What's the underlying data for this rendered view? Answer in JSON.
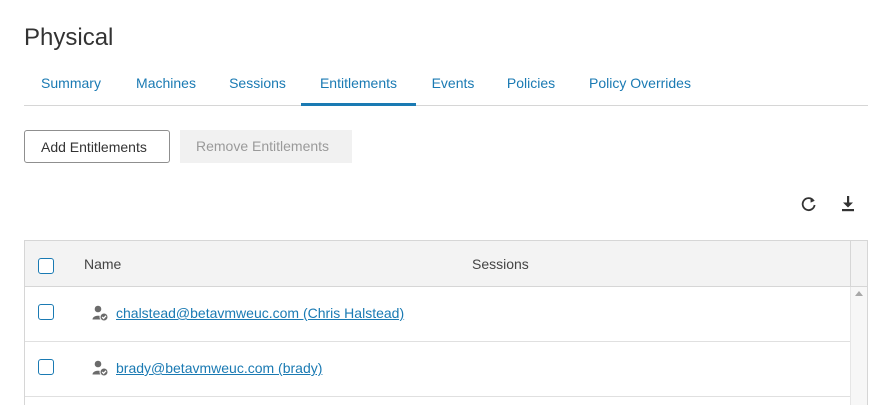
{
  "page": {
    "title": "Physical"
  },
  "tabs": [
    {
      "label": "Summary"
    },
    {
      "label": "Machines"
    },
    {
      "label": "Sessions"
    },
    {
      "label": "Entitlements",
      "active": true
    },
    {
      "label": "Events"
    },
    {
      "label": "Policies"
    },
    {
      "label": "Policy Overrides"
    }
  ],
  "actions": {
    "add_label": "Add Entitlements",
    "remove_label": "Remove Entitlements",
    "remove_disabled": true
  },
  "toolbar": {
    "refresh_icon": "refresh-icon",
    "download_icon": "download-icon"
  },
  "table": {
    "columns": [
      {
        "label": "Name"
      },
      {
        "label": "Sessions"
      }
    ],
    "rows": [
      {
        "name": "chalstead@betavmweuc.com (Chris Halstead)",
        "sessions": ""
      },
      {
        "name": "brady@betavmweuc.com (brady)",
        "sessions": ""
      }
    ]
  },
  "colors": {
    "accent": "#1a7ab3",
    "header_bg": "#f3f3f3",
    "border": "#d6d6d6"
  }
}
